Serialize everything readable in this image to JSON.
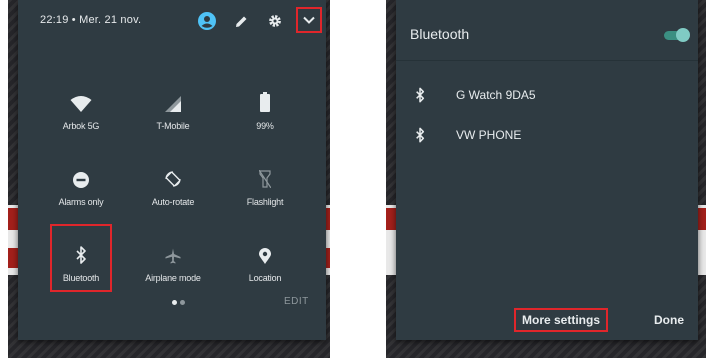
{
  "left": {
    "status": {
      "time_date": "22:19 • Mer. 21 nov."
    },
    "tiles": [
      {
        "icon": "wifi-icon",
        "label": "Arbok 5G"
      },
      {
        "icon": "signal-icon",
        "label": "T-Mobile"
      },
      {
        "icon": "battery-icon",
        "label": "99%"
      },
      {
        "icon": "do-not-disturb-icon",
        "label": "Alarms only"
      },
      {
        "icon": "auto-rotate-icon",
        "label": "Auto-rotate"
      },
      {
        "icon": "flashlight-icon",
        "label": "Flashlight"
      },
      {
        "icon": "bluetooth-icon",
        "label": "Bluetooth"
      },
      {
        "icon": "airplane-icon",
        "label": "Airplane mode"
      },
      {
        "icon": "location-icon",
        "label": "Location"
      }
    ],
    "page_indicator": {
      "pages": 2,
      "current": 1
    },
    "edit_label": "EDIT"
  },
  "right": {
    "title": "Bluetooth",
    "toggle_on": true,
    "devices": [
      {
        "name": "G Watch 9DA5"
      },
      {
        "name": "VW PHONE"
      }
    ],
    "more_settings_label": "More settings",
    "done_label": "Done"
  },
  "colors": {
    "panel": "#2f3b42",
    "accent_toggle": "#80cbc4",
    "profile_icon": "#4fc3f7",
    "highlight": "#e0262b"
  }
}
